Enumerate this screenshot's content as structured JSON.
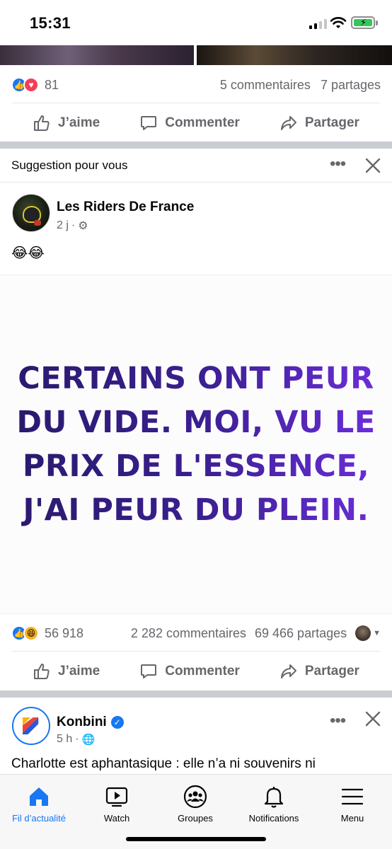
{
  "status": {
    "time": "15:31"
  },
  "post_prev": {
    "reaction_count": "81",
    "comments": "5 commentaires",
    "shares": "7 partages"
  },
  "actions": {
    "like": "J’aime",
    "comment": "Commenter",
    "share": "Partager"
  },
  "suggestion": {
    "label": "Suggestion pour vous"
  },
  "post_main": {
    "author": "Les Riders De France",
    "time": "2 j",
    "text": "😂😂",
    "meme_lines": [
      "CERTAINS ONT PEUR",
      "DU VIDE. MOI, VU LE",
      "PRIX DE L'ESSENCE,",
      "J'AI PEUR DU PLEIN."
    ],
    "reaction_count": "56 918",
    "comments": "2 282 commentaires",
    "shares": "69 466 partages"
  },
  "post_next": {
    "author": "Konbini",
    "time": "5 h",
    "text": "Charlotte est aphantasique : elle n’a ni souvenirs ni"
  },
  "nav": {
    "home": "Fil d’actualité",
    "watch": "Watch",
    "groups": "Groupes",
    "notifications": "Notifications",
    "menu": "Menu"
  },
  "colors": {
    "accent": "#1877f2",
    "muted": "#65676b",
    "divider": "#c9ccd1"
  }
}
